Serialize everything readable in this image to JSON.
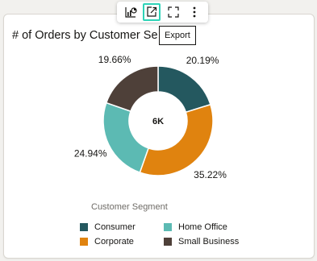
{
  "toolbar": {
    "buttons": [
      {
        "name": "chart-type-icon"
      },
      {
        "name": "export-icon"
      },
      {
        "name": "fullscreen-icon"
      },
      {
        "name": "more-options-icon"
      }
    ],
    "tooltip": "Export"
  },
  "card": {
    "title": "# of Orders by Customer Se"
  },
  "chart_data": {
    "type": "pie",
    "donut": true,
    "title": "# of Orders by Customer Segment",
    "center_label": "6K",
    "categories": [
      "Consumer",
      "Corporate",
      "Home Office",
      "Small Business"
    ],
    "values": [
      20.19,
      35.22,
      24.94,
      19.66
    ],
    "labels": [
      "20.19%",
      "35.22%",
      "24.94%",
      "19.66%"
    ],
    "colors": [
      "#24585f",
      "#e0830f",
      "#5cbab3",
      "#4e4039"
    ],
    "legend_title": "Customer Segment",
    "legend_position": "bottom",
    "legend_order": [
      "Consumer",
      "Home Office",
      "Corporate",
      "Small Business"
    ]
  }
}
